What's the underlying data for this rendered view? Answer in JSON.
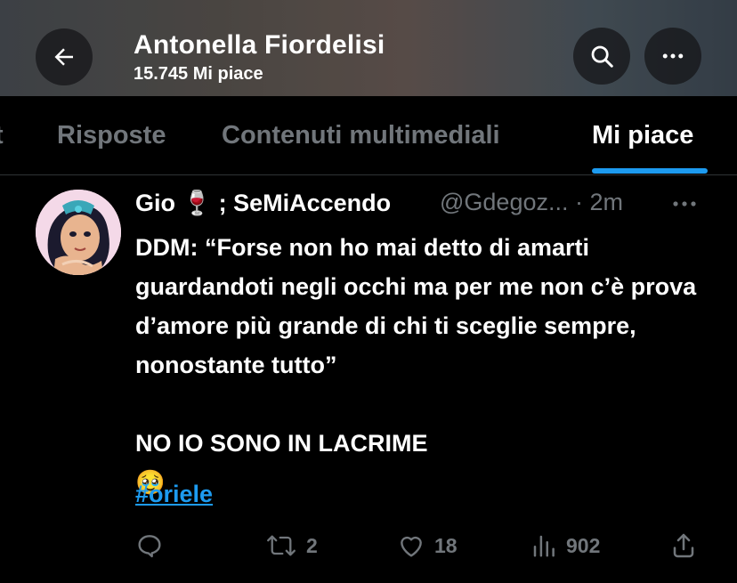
{
  "header": {
    "title": "Antonella Fiordelisi",
    "subtitle": "15.745 Mi piace",
    "back_icon": "back-arrow-icon",
    "search_icon": "search-icon",
    "more_icon": "more-icon"
  },
  "tabs": [
    {
      "label": "t"
    },
    {
      "label": "Risposte"
    },
    {
      "label": "Contenuti multimediali"
    },
    {
      "label": "Mi piace",
      "active": true
    }
  ],
  "tweet": {
    "author_name": "Gio 🍷 ; SeMiAccendo",
    "handle_time": "@Gdegoz... · 2m",
    "text": "DDM: “Forse non ho mai detto di amarti guardandoti negli occhi ma per me non c’è prova d’amore più grande di chi ti sceglie sempre, nonostante tutto”\n\nNO IO SONO IN LACRIME\n🥹",
    "hashtag": "#oriele",
    "stats": {
      "reposts": "2",
      "likes": "18",
      "views": "902"
    }
  },
  "colors": {
    "accent": "#1d9bf0",
    "muted": "#71767b",
    "background": "#000000"
  }
}
